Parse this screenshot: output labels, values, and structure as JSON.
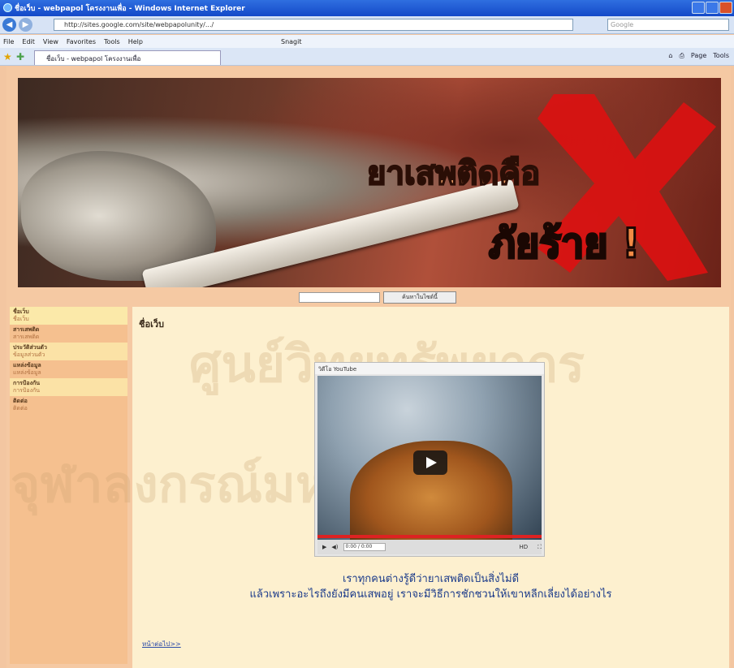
{
  "window": {
    "title": "ชื่อเว็บ - webpapol โครงงานเพื่อ - Windows Internet Explorer",
    "address": "http://sites.google.com/site/webpapolunity/.../",
    "search_placeholder": "Google"
  },
  "menu": {
    "items": [
      "File",
      "Edit",
      "View",
      "Favorites",
      "Tools",
      "Help"
    ],
    "snagit": "Snagit"
  },
  "tab": {
    "label": "ชื่อเว็บ - webpapol โครงงานเพื่อ"
  },
  "commandbar": {
    "items": [
      "Page",
      "Tools"
    ]
  },
  "banner": {
    "title_line1": "ยาเสพติดคือ",
    "title_line2": "ภัยร้าย !"
  },
  "site_search": {
    "button": "ค้นหาในไซต์นี้"
  },
  "sidebar": {
    "groups": [
      {
        "heading": "ชื่อเว็บ",
        "sub": "ชื่อเว็บ"
      },
      {
        "heading": "สารเสพติด",
        "sub": "สารเสพติด"
      },
      {
        "heading": "ประวัติส่วนตัว",
        "sub": "ข้อมูลส่วนตัว"
      },
      {
        "heading": "แหล่งข้อมูล",
        "sub": "แหล่งข้อมูล"
      },
      {
        "heading": "การป้องกัน",
        "sub": "การป้องกัน"
      },
      {
        "heading": "ติดต่อ",
        "sub": "ติดต่อ"
      }
    ]
  },
  "content": {
    "title": "ชื่อเว็บ",
    "watermark_line1": "ศูนย์วิทยทรัพยากร",
    "watermark_line2": "จุฬาลงกรณ์มหาวิทยาลัย",
    "video_title": "วิดีโอ YouTube",
    "video_time": "0:00 / 0:00",
    "caption_line1": "เราทุกคนต่างรู้ดีว่ายาเสพติดเป็นสิ่งไม่ดี",
    "caption_line2": "แล้วเพราะอะไรถึงยังมีคนเสพอยู่ เราจะมีวิธีการชักชวนให้เขาหลีกเลี่ยงได้อย่างไร",
    "more_link": "หน้าต่อไป>>"
  }
}
